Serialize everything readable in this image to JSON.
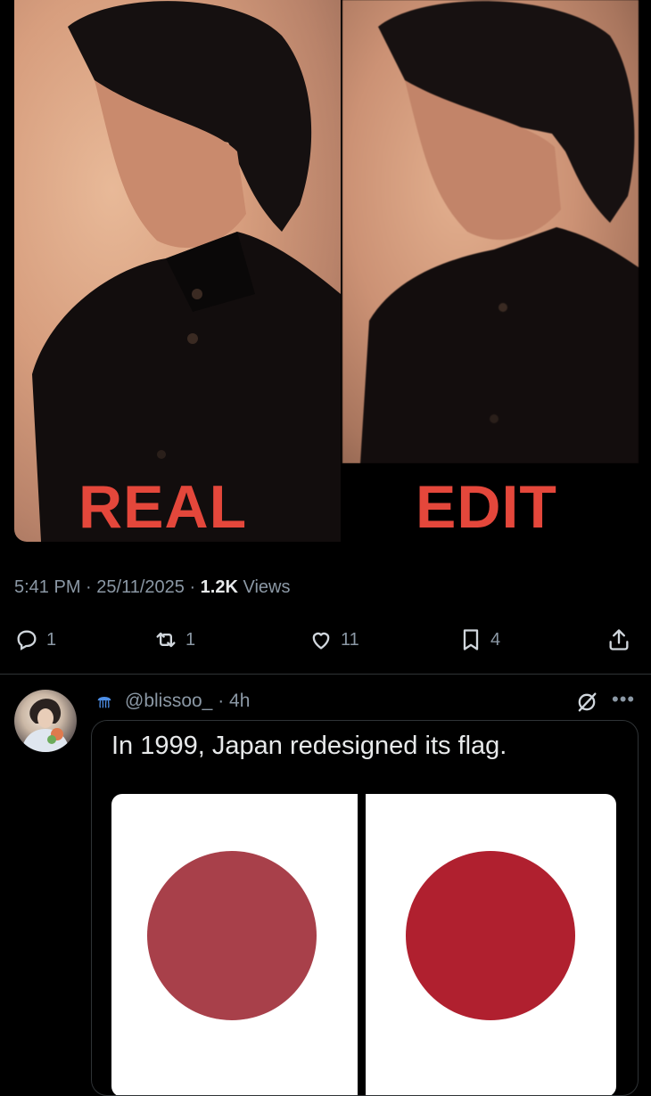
{
  "comparison": {
    "left_caption": "REAL",
    "right_caption": "EDIT",
    "accent_color": "#e4473b"
  },
  "tweet": {
    "time": "5:41 PM",
    "date": "25/11/2025",
    "views_count": "1.2K",
    "views_label": "Views",
    "replies": "1",
    "reposts": "1",
    "likes": "11",
    "bookmarks": "4"
  },
  "reply": {
    "handle": "@blissoo_",
    "age": "4h",
    "emoji_icon": "jellyfish-icon",
    "text": "In 1999, Japan redesigned its flag.",
    "flag_old_color": "#a8404a",
    "flag_new_color": "#b0202f"
  }
}
